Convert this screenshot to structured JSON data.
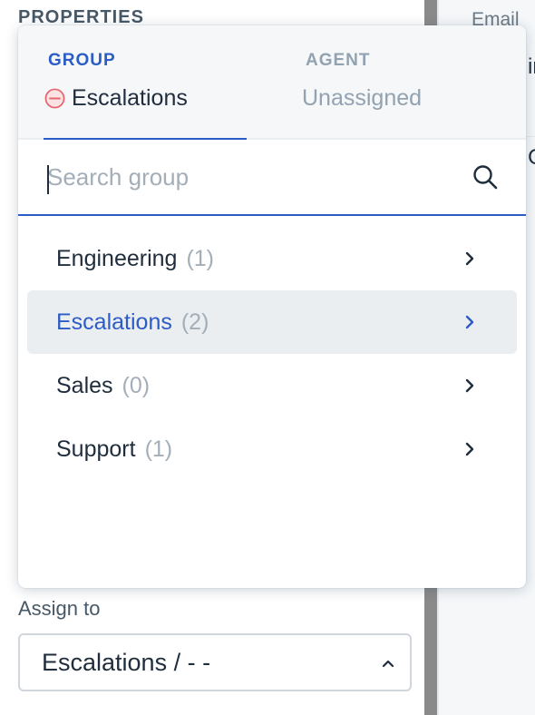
{
  "background": {
    "heading": "PROPERTIES",
    "assign_label": "Assign to",
    "assign_value": "Escalations / - -",
    "right_pane": {
      "email_label": "Email",
      "fragment_1": "ir",
      "fragment_2": "C"
    }
  },
  "dropdown": {
    "tabs": [
      {
        "title": "GROUP",
        "value": "Escalations",
        "active": true,
        "icon": "minus-circle-icon"
      },
      {
        "title": "AGENT",
        "value": "Unassigned",
        "active": false
      }
    ],
    "search": {
      "placeholder": "Search group",
      "value": ""
    },
    "groups": [
      {
        "name": "Engineering",
        "count": "(1)",
        "selected": false
      },
      {
        "name": "Escalations",
        "count": "(2)",
        "selected": true
      },
      {
        "name": "Sales",
        "count": "(0)",
        "selected": false
      },
      {
        "name": "Support",
        "count": "(1)",
        "selected": false
      }
    ]
  },
  "colors": {
    "accent": "#2c5cc5",
    "muted_text": "#a3aeb9",
    "selected_bg": "#ebeef1",
    "header_bg": "#f5f7f9",
    "minus_icon": "#e5656f"
  }
}
